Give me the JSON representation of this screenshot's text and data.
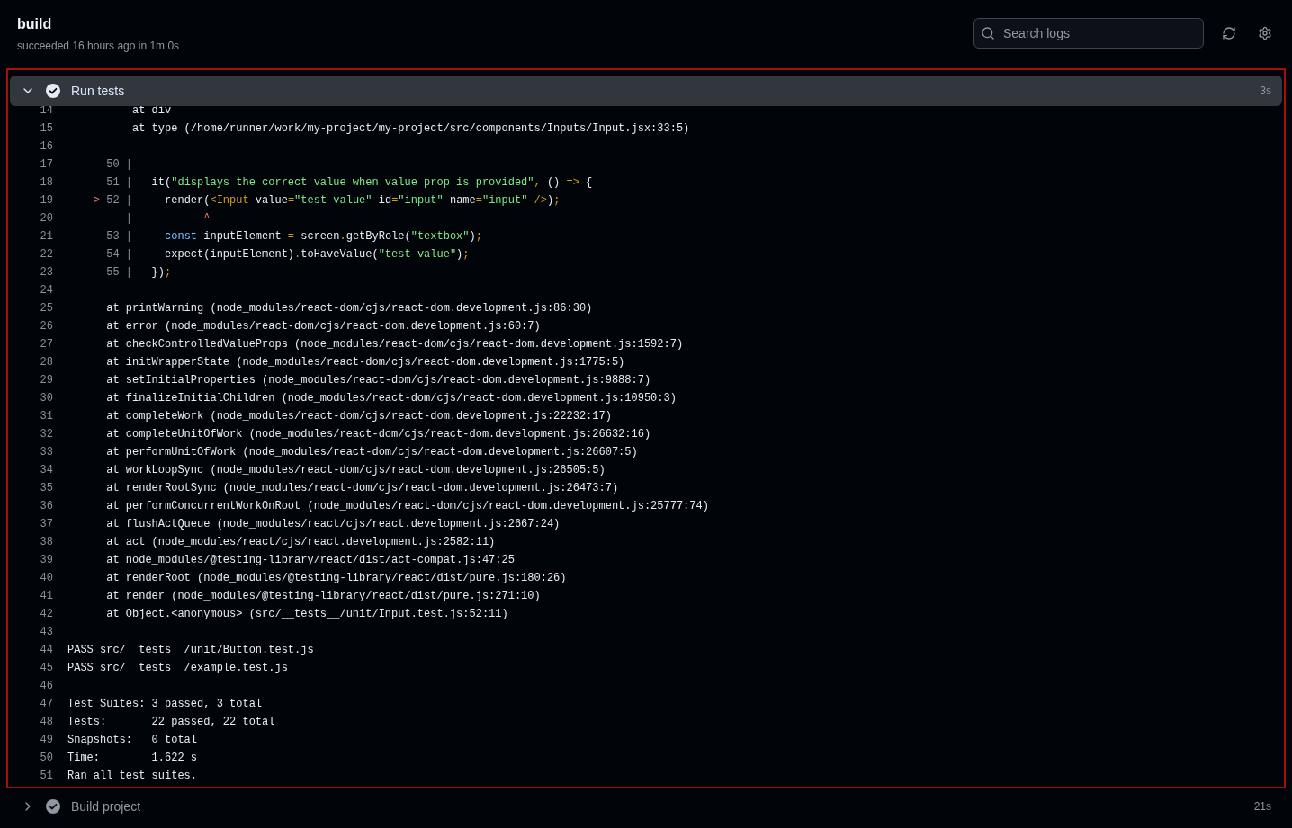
{
  "job": {
    "title": "build",
    "subtitle": "succeeded 16 hours ago in 1m 0s"
  },
  "search": {
    "placeholder": "Search logs"
  },
  "steps": [
    {
      "name": "Run tests",
      "duration": "3s",
      "expanded": true,
      "lines": [
        {
          "number": "14",
          "segments": [
            {
              "kind": "plain",
              "text": "          at div"
            }
          ]
        },
        {
          "number": "15",
          "segments": [
            {
              "kind": "plain",
              "text": "          at type (/home/runner/work/my-project/my-project/src/components/Inputs/Input.jsx:33:5)"
            }
          ]
        },
        {
          "number": "16"
        },
        {
          "number": "17",
          "segments": [
            {
              "kind": "dim",
              "text": "      50 |"
            }
          ]
        },
        {
          "number": "18",
          "segments": [
            {
              "kind": "dim",
              "text": "      51 |"
            },
            {
              "kind": "plain",
              "text": "   it("
            },
            {
              "kind": "string",
              "text": "\"displays the correct value when value prop is provided\""
            },
            {
              "kind": "punct",
              "text": ","
            },
            {
              "kind": "plain",
              "text": " () "
            },
            {
              "kind": "punct",
              "text": "=>"
            },
            {
              "kind": "plain",
              "text": " {"
            }
          ]
        },
        {
          "number": "19",
          "segments": [
            {
              "kind": "pointer",
              "text": "    >"
            },
            {
              "kind": "dim",
              "text": " 52 |"
            },
            {
              "kind": "plain",
              "text": "     render("
            },
            {
              "kind": "punct",
              "text": "<Input"
            },
            {
              "kind": "plain",
              "text": " value"
            },
            {
              "kind": "punct",
              "text": "="
            },
            {
              "kind": "string",
              "text": "\"test value\""
            },
            {
              "kind": "plain",
              "text": " id"
            },
            {
              "kind": "punct",
              "text": "="
            },
            {
              "kind": "string",
              "text": "\"input\""
            },
            {
              "kind": "plain",
              "text": " name"
            },
            {
              "kind": "punct",
              "text": "="
            },
            {
              "kind": "string",
              "text": "\"input\""
            },
            {
              "kind": "punct",
              "text": " />"
            },
            {
              "kind": "plain",
              "text": ")"
            },
            {
              "kind": "punct",
              "text": ";"
            }
          ]
        },
        {
          "number": "20",
          "segments": [
            {
              "kind": "dim",
              "text": "         |"
            },
            {
              "kind": "pointer",
              "text": "           ^"
            }
          ]
        },
        {
          "number": "21",
          "segments": [
            {
              "kind": "dim",
              "text": "      53 |"
            },
            {
              "kind": "keyword",
              "text": "     const"
            },
            {
              "kind": "plain",
              "text": " inputElement "
            },
            {
              "kind": "punct",
              "text": "="
            },
            {
              "kind": "plain",
              "text": " screen"
            },
            {
              "kind": "punct",
              "text": "."
            },
            {
              "kind": "plain",
              "text": "getByRole("
            },
            {
              "kind": "string",
              "text": "\"textbox\""
            },
            {
              "kind": "plain",
              "text": ")"
            },
            {
              "kind": "punct",
              "text": ";"
            }
          ]
        },
        {
          "number": "22",
          "segments": [
            {
              "kind": "dim",
              "text": "      54 |"
            },
            {
              "kind": "plain",
              "text": "     expect(inputElement)"
            },
            {
              "kind": "punct",
              "text": "."
            },
            {
              "kind": "plain",
              "text": "toHaveValue("
            },
            {
              "kind": "string",
              "text": "\"test value\""
            },
            {
              "kind": "plain",
              "text": ")"
            },
            {
              "kind": "punct",
              "text": ";"
            }
          ]
        },
        {
          "number": "23",
          "segments": [
            {
              "kind": "dim",
              "text": "      55 |"
            },
            {
              "kind": "plain",
              "text": "   })"
            },
            {
              "kind": "punct",
              "text": ";"
            }
          ]
        },
        {
          "number": "24"
        },
        {
          "number": "25",
          "segments": [
            {
              "kind": "plain",
              "text": "      at printWarning (node_modules/react-dom/cjs/react-dom.development.js:86:30)"
            }
          ]
        },
        {
          "number": "26",
          "segments": [
            {
              "kind": "plain",
              "text": "      at error (node_modules/react-dom/cjs/react-dom.development.js:60:7)"
            }
          ]
        },
        {
          "number": "27",
          "segments": [
            {
              "kind": "plain",
              "text": "      at checkControlledValueProps (node_modules/react-dom/cjs/react-dom.development.js:1592:7)"
            }
          ]
        },
        {
          "number": "28",
          "segments": [
            {
              "kind": "plain",
              "text": "      at initWrapperState (node_modules/react-dom/cjs/react-dom.development.js:1775:5)"
            }
          ]
        },
        {
          "number": "29",
          "segments": [
            {
              "kind": "plain",
              "text": "      at setInitialProperties (node_modules/react-dom/cjs/react-dom.development.js:9888:7)"
            }
          ]
        },
        {
          "number": "30",
          "segments": [
            {
              "kind": "plain",
              "text": "      at finalizeInitialChildren (node_modules/react-dom/cjs/react-dom.development.js:10950:3)"
            }
          ]
        },
        {
          "number": "31",
          "segments": [
            {
              "kind": "plain",
              "text": "      at completeWork (node_modules/react-dom/cjs/react-dom.development.js:22232:17)"
            }
          ]
        },
        {
          "number": "32",
          "segments": [
            {
              "kind": "plain",
              "text": "      at completeUnitOfWork (node_modules/react-dom/cjs/react-dom.development.js:26632:16)"
            }
          ]
        },
        {
          "number": "33",
          "segments": [
            {
              "kind": "plain",
              "text": "      at performUnitOfWork (node_modules/react-dom/cjs/react-dom.development.js:26607:5)"
            }
          ]
        },
        {
          "number": "34",
          "segments": [
            {
              "kind": "plain",
              "text": "      at workLoopSync (node_modules/react-dom/cjs/react-dom.development.js:26505:5)"
            }
          ]
        },
        {
          "number": "35",
          "segments": [
            {
              "kind": "plain",
              "text": "      at renderRootSync (node_modules/react-dom/cjs/react-dom.development.js:26473:7)"
            }
          ]
        },
        {
          "number": "36",
          "segments": [
            {
              "kind": "plain",
              "text": "      at performConcurrentWorkOnRoot (node_modules/react-dom/cjs/react-dom.development.js:25777:74)"
            }
          ]
        },
        {
          "number": "37",
          "segments": [
            {
              "kind": "plain",
              "text": "      at flushActQueue (node_modules/react/cjs/react.development.js:2667:24)"
            }
          ]
        },
        {
          "number": "38",
          "segments": [
            {
              "kind": "plain",
              "text": "      at act (node_modules/react/cjs/react.development.js:2582:11)"
            }
          ]
        },
        {
          "number": "39",
          "segments": [
            {
              "kind": "plain",
              "text": "      at node_modules/@testing-library/react/dist/act-compat.js:47:25"
            }
          ]
        },
        {
          "number": "40",
          "segments": [
            {
              "kind": "plain",
              "text": "      at renderRoot (node_modules/@testing-library/react/dist/pure.js:180:26)"
            }
          ]
        },
        {
          "number": "41",
          "segments": [
            {
              "kind": "plain",
              "text": "      at render (node_modules/@testing-library/react/dist/pure.js:271:10)"
            }
          ]
        },
        {
          "number": "42",
          "segments": [
            {
              "kind": "plain",
              "text": "      at Object.<anonymous> (src/__tests__/unit/Input.test.js:52:11)"
            }
          ]
        },
        {
          "number": "43"
        },
        {
          "number": "44",
          "segments": [
            {
              "kind": "plain",
              "text": "PASS src/__tests__/unit/Button.test.js"
            }
          ]
        },
        {
          "number": "45",
          "segments": [
            {
              "kind": "plain",
              "text": "PASS src/__tests__/example.test.js"
            }
          ]
        },
        {
          "number": "46"
        },
        {
          "number": "47",
          "segments": [
            {
              "kind": "plain",
              "text": "Test Suites: 3 passed, 3 total"
            }
          ]
        },
        {
          "number": "48",
          "segments": [
            {
              "kind": "plain",
              "text": "Tests:       22 passed, 22 total"
            }
          ]
        },
        {
          "number": "49",
          "segments": [
            {
              "kind": "plain",
              "text": "Snapshots:   0 total"
            }
          ]
        },
        {
          "number": "50",
          "segments": [
            {
              "kind": "plain",
              "text": "Time:        1.622 s"
            }
          ]
        },
        {
          "number": "51",
          "segments": [
            {
              "kind": "plain",
              "text": "Ran all test suites."
            }
          ]
        }
      ]
    },
    {
      "name": "Build project",
      "duration": "21s",
      "expanded": false
    }
  ]
}
